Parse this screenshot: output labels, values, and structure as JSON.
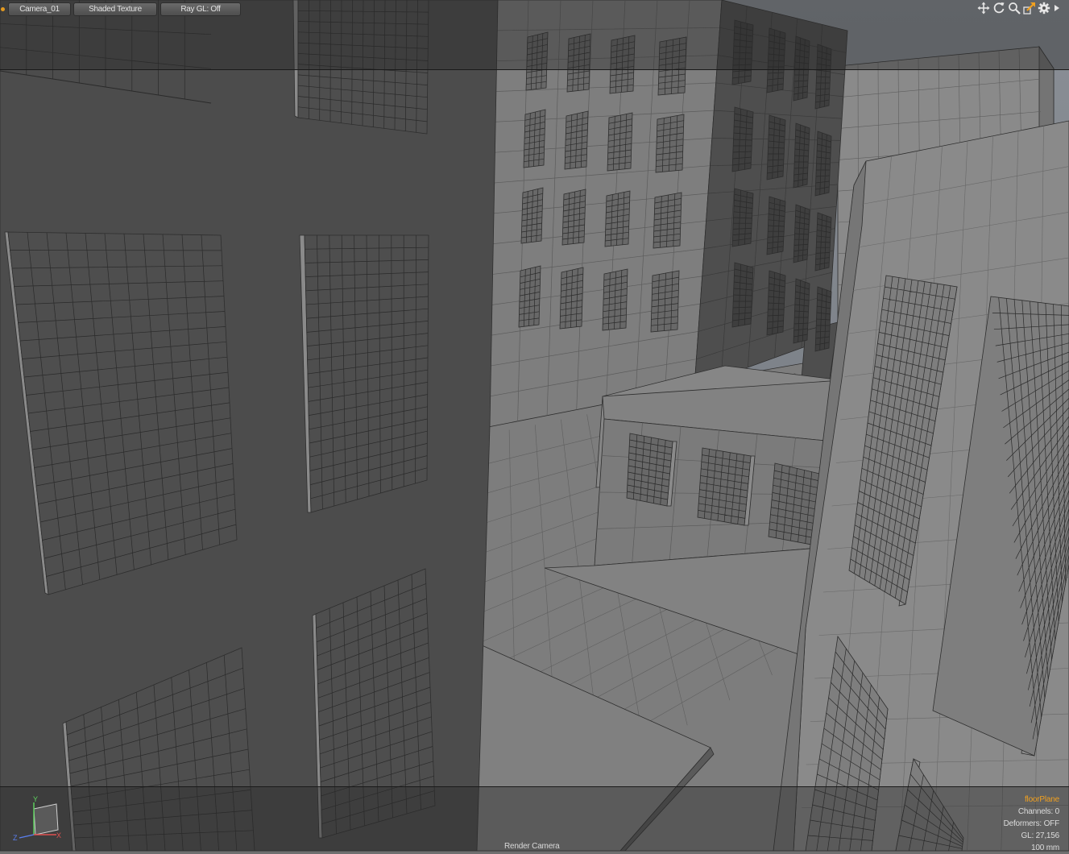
{
  "toolbar": {
    "camera": "Camera_01",
    "shading": "Shaded Texture",
    "raygl": "Ray GL: Off"
  },
  "nav_icons": [
    "move-view-icon",
    "rotate-view-icon",
    "zoom-view-icon",
    "maximize-view-icon",
    "gear-icon",
    "expand-arrow-icon"
  ],
  "gizmo": {
    "y": "Y",
    "z": "Z",
    "x": "X"
  },
  "info": {
    "selection": "floorPlane",
    "channels": "Channels: 0",
    "deformers": "Deformers: OFF",
    "gl": "GL: 27,156",
    "scale": "100 mm"
  },
  "caption": "Render Camera",
  "colors": {
    "accent": "#f0a020",
    "viewport_bg": "#6f6f6f",
    "wireframe": "#2b2b2b"
  }
}
